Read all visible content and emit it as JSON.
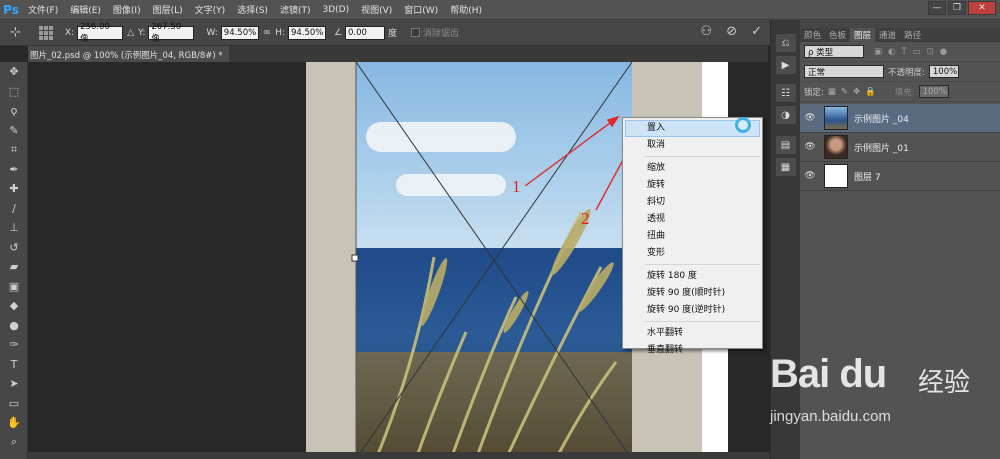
{
  "app": {
    "logo": "Ps"
  },
  "menu": [
    "文件(F)",
    "编辑(E)",
    "图像(I)",
    "图层(L)",
    "文字(Y)",
    "选择(S)",
    "滤镜(T)",
    "3D(D)",
    "视图(V)",
    "窗口(W)",
    "帮助(H)"
  ],
  "window_buttons": {
    "minimize": "—",
    "restore": "❐",
    "close": "✕"
  },
  "options": {
    "x_label": "X:",
    "x_value": "256.00 像",
    "y_label": "Y:",
    "y_value": "267.50 像",
    "w_label": "W:",
    "w_value": "94.50%",
    "h_label": "H:",
    "h_value": "94.50%",
    "angle_value": "0.00",
    "angle_unit": "度",
    "antialias_label": "消除锯齿"
  },
  "tab": {
    "title": "图片_02.psd @ 100% (示例图片_04, RGB/8#) *"
  },
  "annotations": {
    "arrow1": "1",
    "arrow2": "2"
  },
  "context_menu": {
    "items": [
      "置入",
      "取消"
    ],
    "group2": [
      "缩放",
      "旋转",
      "斜切",
      "透视",
      "扭曲",
      "变形"
    ],
    "group3": [
      "旋转 180 度",
      "旋转 90 度(顺时针)",
      "旋转 90 度(逆时针)"
    ],
    "group4": [
      "水平翻转",
      "垂直翻转"
    ]
  },
  "panel": {
    "tabs": [
      "颜色",
      "色板",
      "图层",
      "通道",
      "路径"
    ],
    "filter_label": "ρ 类型",
    "blend_mode": "正常",
    "opacity_label": "不透明度:",
    "opacity_value": "100%",
    "lock_label": "锁定:",
    "fill_label": "填充:",
    "fill_value": "100%",
    "layers": [
      {
        "name": "示例图片 _04",
        "active": true
      },
      {
        "name": "示例图片 _01",
        "active": false
      },
      {
        "name": "图层 7",
        "active": false
      }
    ]
  },
  "watermark": {
    "logo": "Bai du",
    "zh": "经验",
    "url": "jingyan.baidu.com"
  },
  "colors": {
    "accent": "#31a8ff",
    "highlight": "#cde3f7",
    "arrow": "#e02828"
  }
}
